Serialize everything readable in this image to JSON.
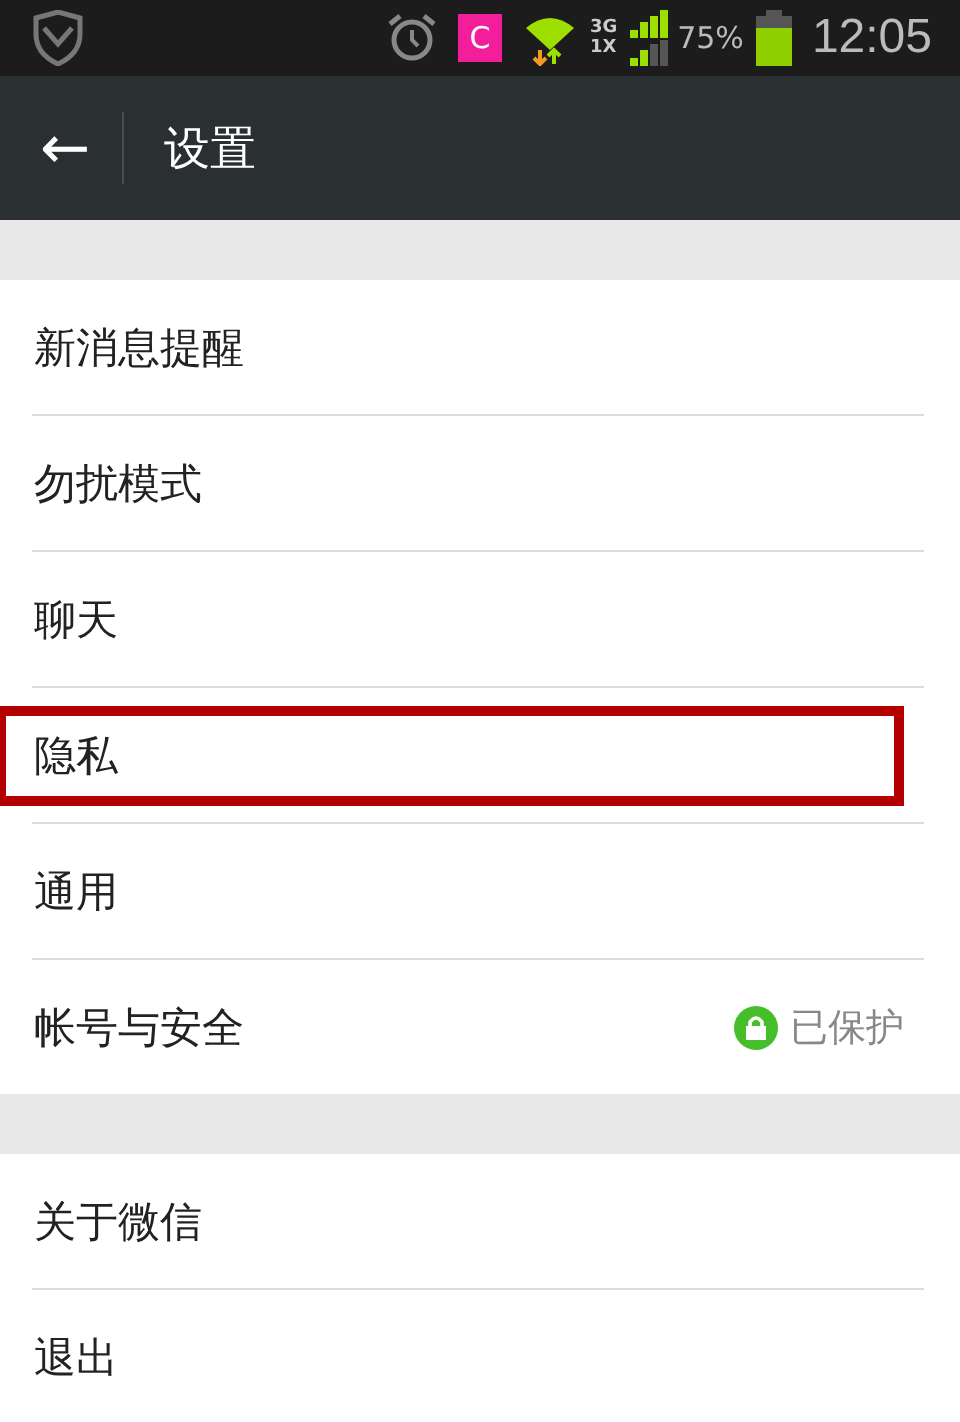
{
  "status_bar": {
    "app_icon_letter": "C",
    "network_top": "3G",
    "network_bottom": "1X",
    "battery_text": "75%",
    "time": "12:05"
  },
  "title_bar": {
    "back_icon": "←",
    "title": "设置"
  },
  "sections": [
    {
      "items": [
        {
          "label": "新消息提醒",
          "highlighted": false
        },
        {
          "label": "勿扰模式",
          "highlighted": false
        },
        {
          "label": "聊天",
          "highlighted": false
        },
        {
          "label": "隐私",
          "highlighted": true
        },
        {
          "label": "通用",
          "highlighted": false
        },
        {
          "label": "帐号与安全",
          "highlighted": false,
          "status": "已保护"
        }
      ]
    },
    {
      "items": [
        {
          "label": "关于微信",
          "highlighted": false
        },
        {
          "label": "退出",
          "highlighted": false
        }
      ]
    }
  ]
}
